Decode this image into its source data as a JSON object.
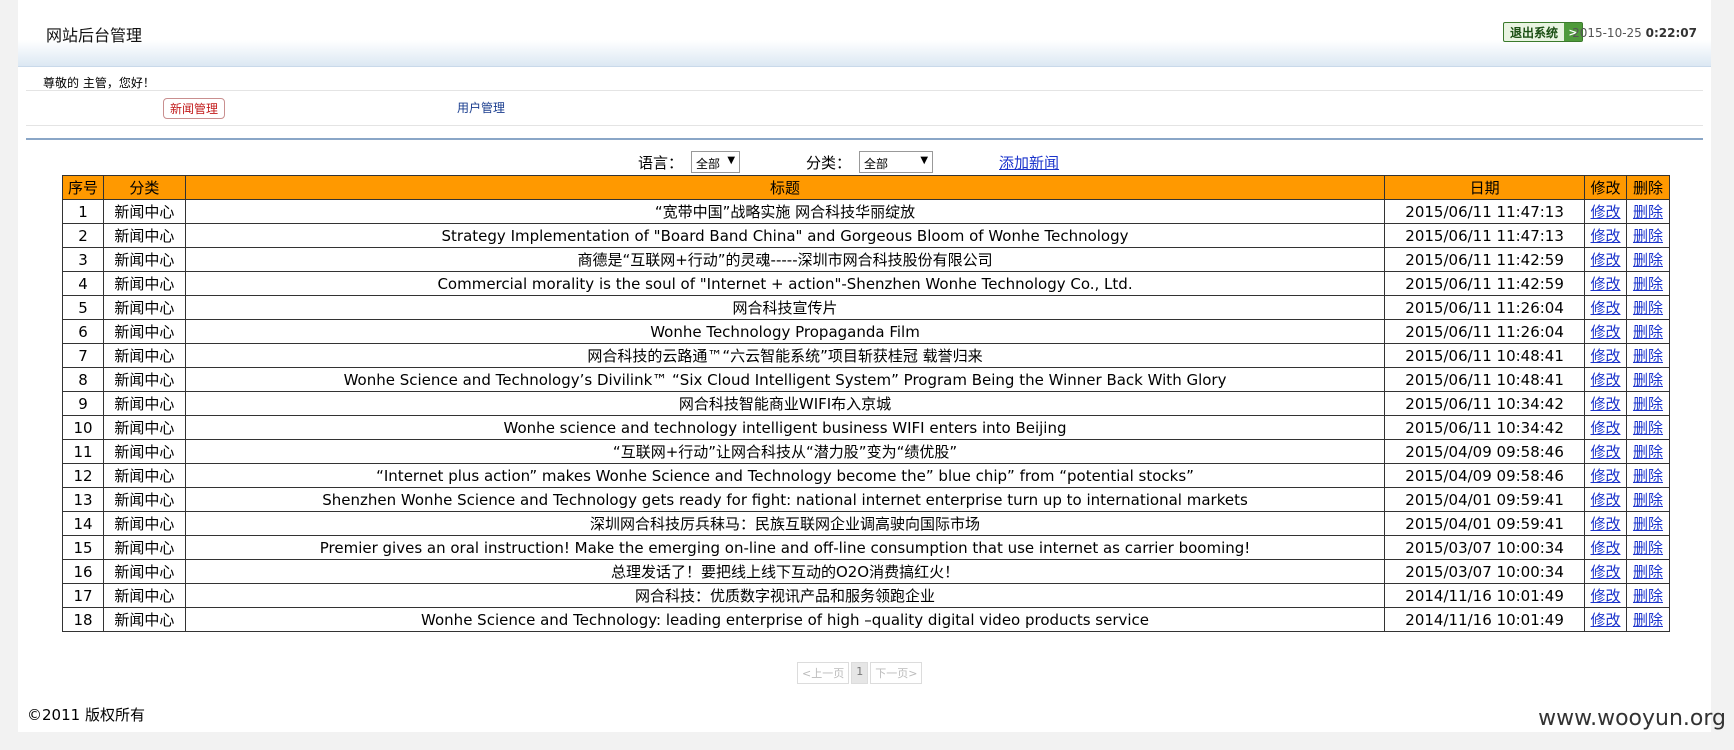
{
  "header": {
    "title": "网站后台管理",
    "logout_label": "退出系统",
    "date": "2015-10-25",
    "time": "0:22:07"
  },
  "greeting": "尊敬的 主管，您好！",
  "nav": {
    "tabs": [
      {
        "label": "新闻管理",
        "active": true
      },
      {
        "label": "用户管理",
        "active": false
      }
    ]
  },
  "filters": {
    "language_label": "语言：",
    "language_value": "全部",
    "category_label": "分类：",
    "category_value": "全部",
    "add_news_label": "添加新闻"
  },
  "table": {
    "headers": [
      "序号",
      "分类",
      "标题",
      "日期",
      "修改",
      "删除"
    ],
    "edit_label": "修改",
    "delete_label": "删除",
    "rows": [
      {
        "no": "1",
        "category": "新闻中心",
        "title": "“宽带中国”战略实施 网合科技华丽绽放",
        "date": "2015/06/11 11:47:13"
      },
      {
        "no": "2",
        "category": "新闻中心",
        "title": "Strategy Implementation of \"Board Band China\" and Gorgeous Bloom of Wonhe Technology",
        "date": "2015/06/11 11:47:13"
      },
      {
        "no": "3",
        "category": "新闻中心",
        "title": "商德是“互联网+行动”的灵魂-----深圳市网合科技股份有限公司",
        "date": "2015/06/11 11:42:59"
      },
      {
        "no": "4",
        "category": "新闻中心",
        "title": "Commercial morality is the soul of \"Internet + action\"-Shenzhen Wonhe Technology Co., Ltd.",
        "date": "2015/06/11 11:42:59"
      },
      {
        "no": "5",
        "category": "新闻中心",
        "title": "网合科技宣传片",
        "date": "2015/06/11 11:26:04"
      },
      {
        "no": "6",
        "category": "新闻中心",
        "title": "Wonhe Technology Propaganda Film",
        "date": "2015/06/11 11:26:04"
      },
      {
        "no": "7",
        "category": "新闻中心",
        "title": "网合科技的云路通™“六云智能系统”项目斩获桂冠 载誉归来",
        "date": "2015/06/11 10:48:41"
      },
      {
        "no": "8",
        "category": "新闻中心",
        "title": "Wonhe Science and Technology’s Divilink™ “Six Cloud Intelligent System” Program Being the Winner Back With Glory",
        "date": "2015/06/11 10:48:41"
      },
      {
        "no": "9",
        "category": "新闻中心",
        "title": "网合科技智能商业WIFI布入京城",
        "date": "2015/06/11 10:34:42"
      },
      {
        "no": "10",
        "category": "新闻中心",
        "title": "Wonhe science and technology intelligent business WIFI enters into Beijing",
        "date": "2015/06/11 10:34:42"
      },
      {
        "no": "11",
        "category": "新闻中心",
        "title": "“互联网+行动”让网合科技从“潜力股”变为“绩优股”",
        "date": "2015/04/09 09:58:46"
      },
      {
        "no": "12",
        "category": "新闻中心",
        "title": "“Internet plus action” makes Wonhe Science and Technology become the” blue chip” from “potential stocks”",
        "date": "2015/04/09 09:58:46"
      },
      {
        "no": "13",
        "category": "新闻中心",
        "title": "Shenzhen Wonhe Science and Technology gets ready for fight: national internet enterprise turn up to international markets",
        "date": "2015/04/01 09:59:41"
      },
      {
        "no": "14",
        "category": "新闻中心",
        "title": "深圳网合科技厉兵秣马：民族互联网企业调高驶向国际市场",
        "date": "2015/04/01 09:59:41"
      },
      {
        "no": "15",
        "category": "新闻中心",
        "title": "Premier gives an oral instruction! Make the emerging on-line and off-line consumption that use internet as carrier booming!",
        "date": "2015/03/07 10:00:34"
      },
      {
        "no": "16",
        "category": "新闻中心",
        "title": "总理发话了！要把线上线下互动的O2O消费搞红火！",
        "date": "2015/03/07 10:00:34"
      },
      {
        "no": "17",
        "category": "新闻中心",
        "title": "网合科技：优质数字视讯产品和服务领跑企业",
        "date": "2014/11/16 10:01:49"
      },
      {
        "no": "18",
        "category": "新闻中心",
        "title": "Wonhe Science and Technology: leading enterprise of high –quality digital video products service",
        "date": "2014/11/16 10:01:49"
      }
    ]
  },
  "pager": {
    "prev_label": "<上一页",
    "current_page": "1",
    "next_label": "下一页>"
  },
  "footer": "©2011 版权所有",
  "watermark": "www.wooyun.org"
}
